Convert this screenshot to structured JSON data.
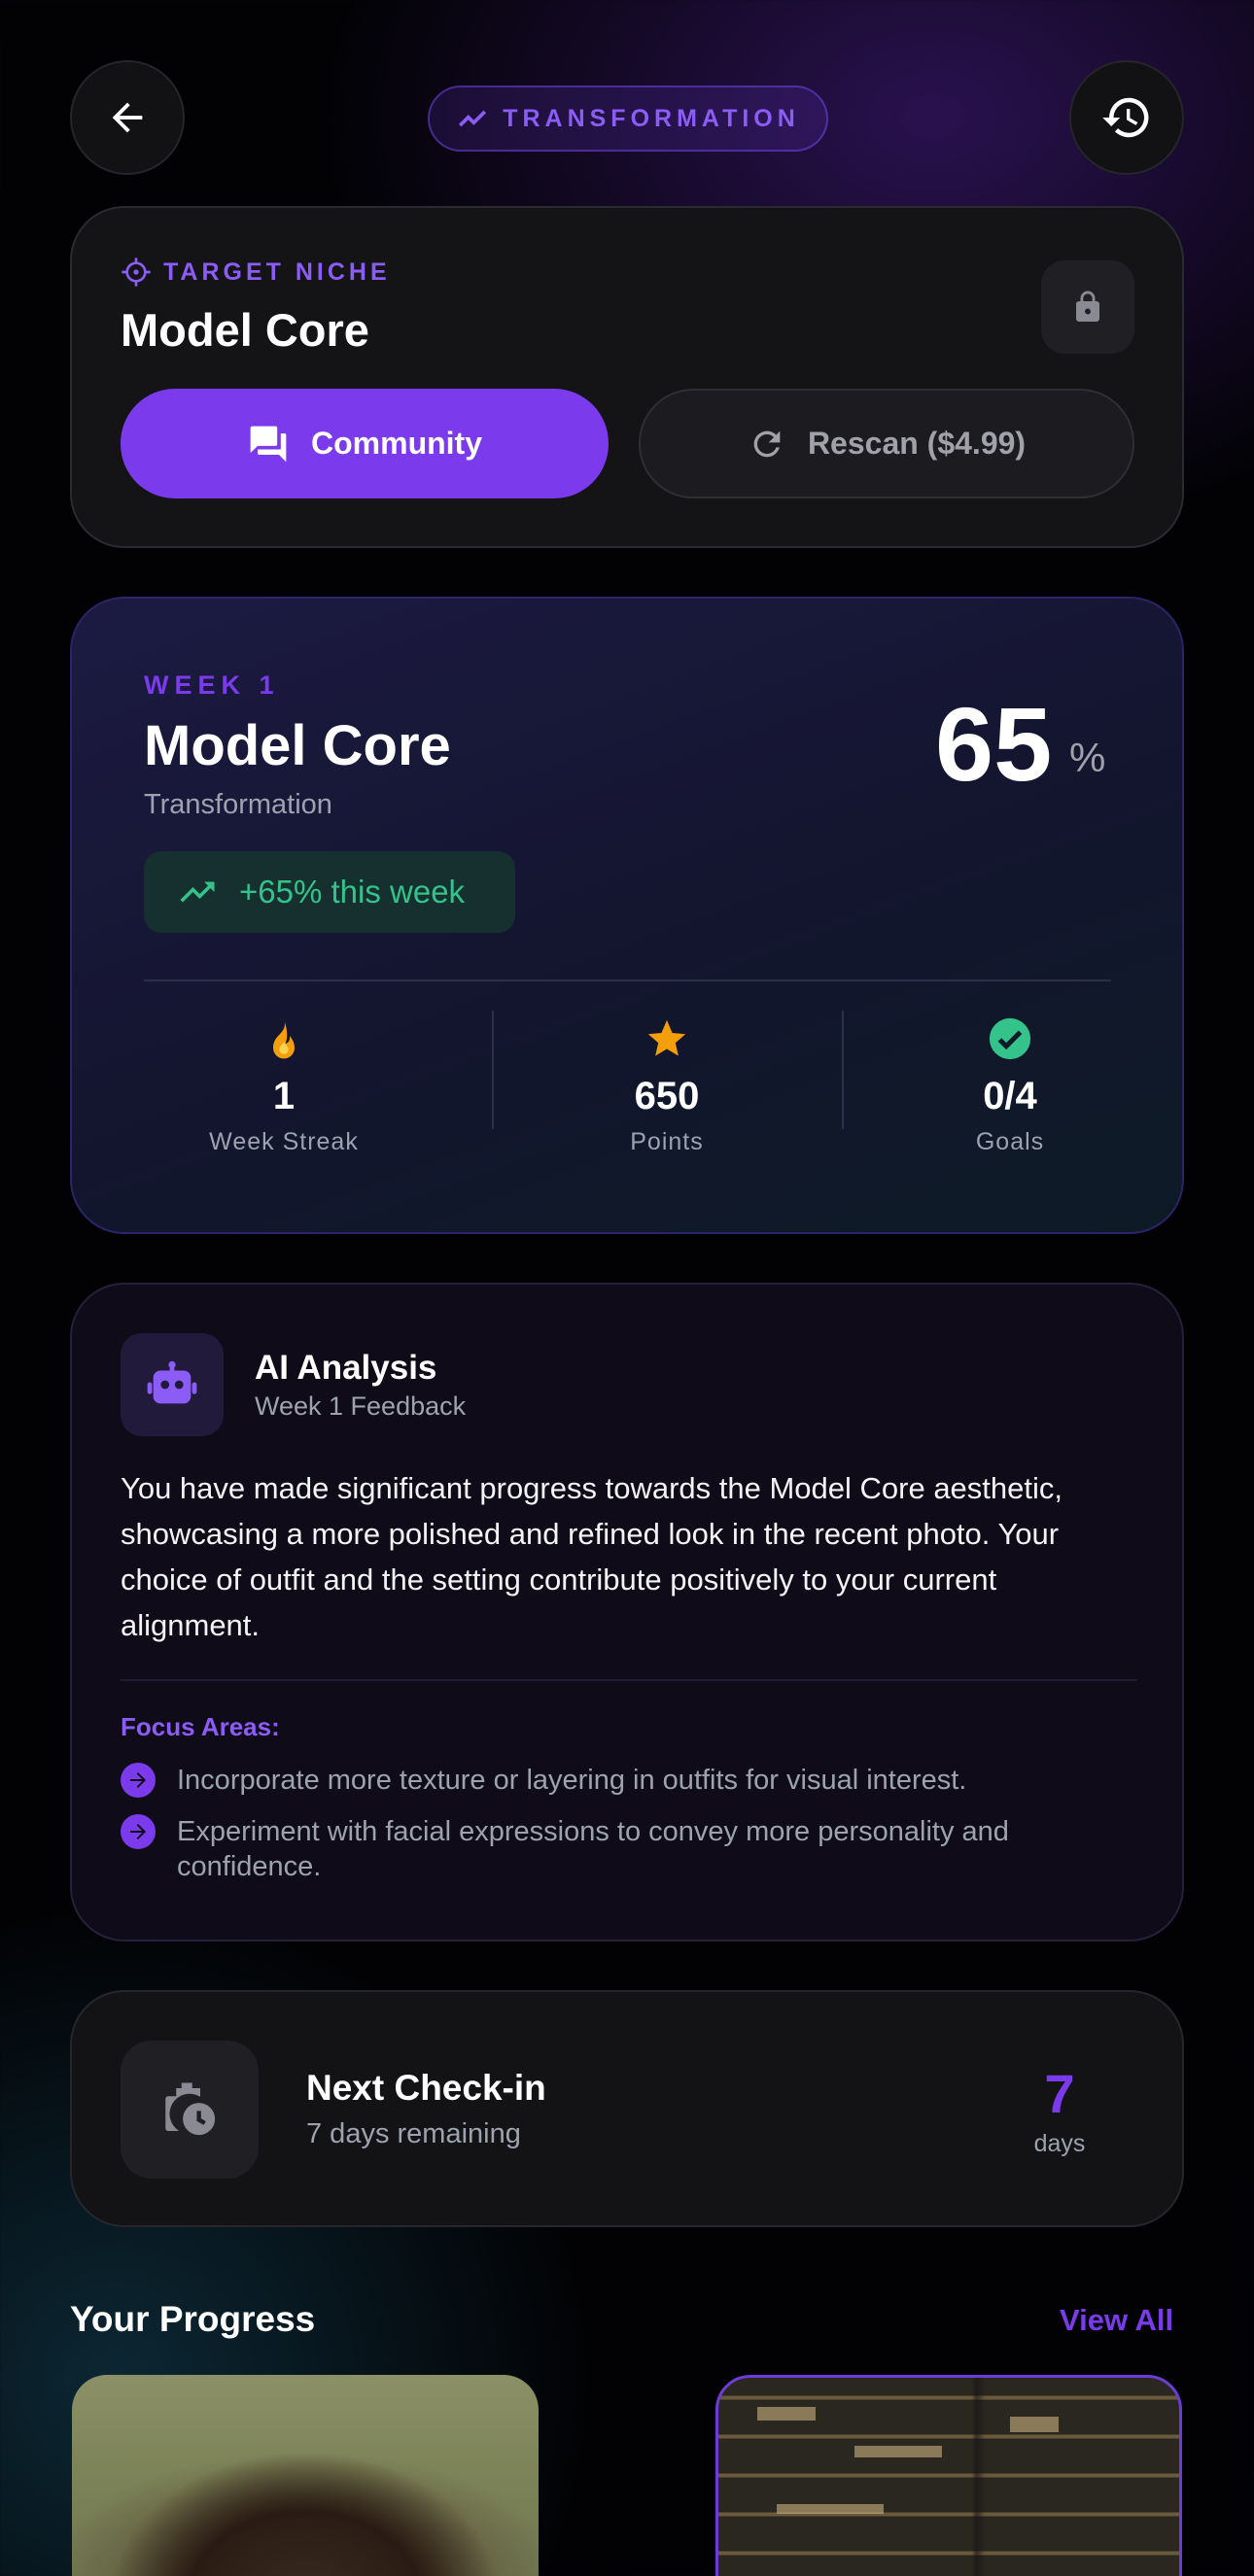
{
  "header": {
    "back_icon": "arrow-left-icon",
    "badge_icon": "trending-line-icon",
    "badge_label": "TRANSFORMATION",
    "history_icon": "history-icon"
  },
  "niche": {
    "label": "TARGET NICHE",
    "title": "Model Core",
    "lock_icon": "lock-icon",
    "community_label": "Community",
    "rescan_label": "Rescan ($4.99)"
  },
  "week": {
    "label": "WEEK 1",
    "title": "Model Core",
    "subtitle": "Transformation",
    "percent": "65",
    "percent_sign": "%",
    "trend": "+65% this week",
    "stats": [
      {
        "icon": "fire-icon",
        "value": "1",
        "label": "Week Streak"
      },
      {
        "icon": "star-icon",
        "value": "650",
        "label": "Points"
      },
      {
        "icon": "check-circle-icon",
        "value": "0/4",
        "label": "Goals"
      }
    ]
  },
  "ai": {
    "title": "AI Analysis",
    "subtitle": "Week 1 Feedback",
    "body": "You have made significant progress towards the Model Core aesthetic, showcasing a more polished and refined look in the recent photo. Your choice of outfit and the setting contribute positively to your current alignment.",
    "focus_label": "Focus Areas:",
    "focus_items": [
      "Incorporate more texture or layering in outfits for visual interest.",
      "Experiment with facial expressions to convey more personality and confidence."
    ]
  },
  "checkin": {
    "title": "Next Check-in",
    "subtitle": "7 days remaining",
    "days_value": "7",
    "days_label": "days"
  },
  "progress": {
    "title": "Your Progress",
    "view_all": "View All"
  },
  "colors": {
    "accent": "#7c3aed",
    "success": "#34c38a",
    "fire": "#f59e0b"
  }
}
